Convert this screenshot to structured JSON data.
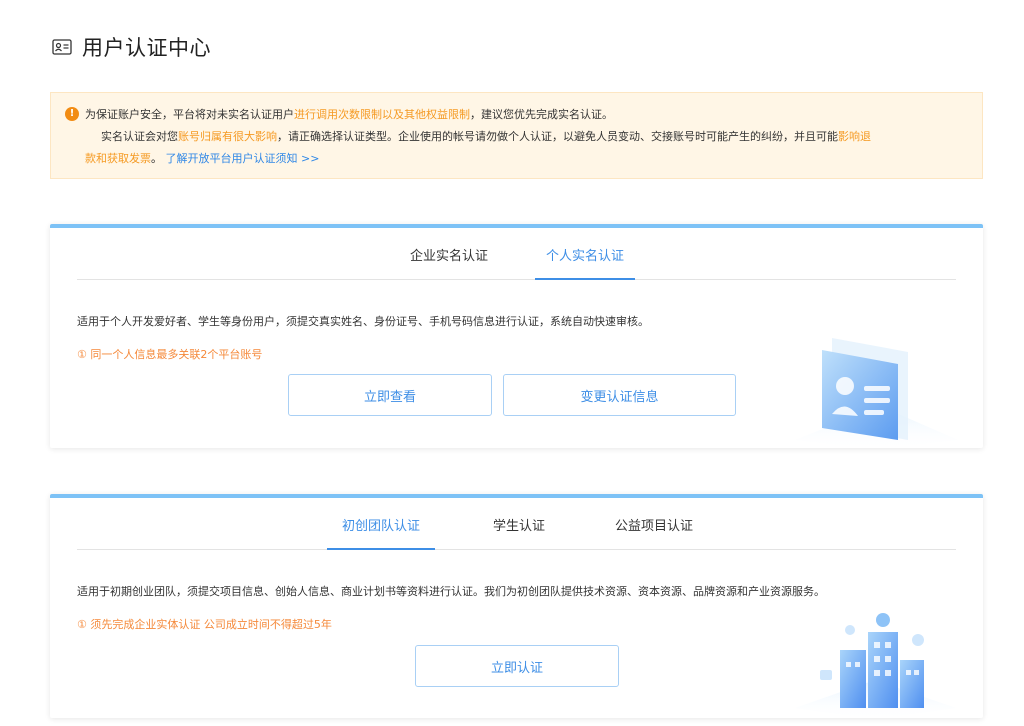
{
  "header": {
    "title": "用户认证中心",
    "icon": "id-card-icon"
  },
  "notice": {
    "icon": "warning-circle-icon",
    "line1_a": "为保证账户安全，平台将对未实名认证用户",
    "line1_hl": "进行调用次数限制以及其他权益限制",
    "line1_b": "，建议您优先完成实名认证。",
    "line2_a": "实名认证会对您",
    "line2_hl": "账号归属有很大影响",
    "line2_b": "，请正确选择认证类型。企业使用的帐号请勿做个人认证，以避免人员变动、交接账号时可能产生的纠纷，并且可能",
    "line2_hl2": "影响退",
    "line3_hl": "款和获取发票",
    "line3_b": "。",
    "line3_link": "了解开放平台用户认证须知 >>",
    "colors": {
      "background": "#fff6e6",
      "highlight": "#f59a23",
      "link": "#2f87e6"
    }
  },
  "card1": {
    "tabs": [
      {
        "label": "企业实名认证",
        "active": false
      },
      {
        "label": "个人实名认证",
        "active": true
      }
    ],
    "description": "适用于个人开发爱好者、学生等身份用户，须提交真实姓名、身份证号、手机号码信息进行认证，系统自动快速审核。",
    "tip": "① 同一个人信息最多关联2个平台账号",
    "buttons": {
      "view": "立即查看",
      "change": "变更认证信息"
    },
    "illustration": "id-card-illustration-icon"
  },
  "card2": {
    "tabs": [
      {
        "label": "初创团队认证",
        "active": true
      },
      {
        "label": "学生认证",
        "active": false
      },
      {
        "label": "公益项目认证",
        "active": false
      }
    ],
    "description": "适用于初期创业团队，须提交项目信息、创始人信息、商业计划书等资料进行认证。我们为初创团队提供技术资源、资本资源、品牌资源和产业资源服务。",
    "tip": "① 须先完成企业实体认证 公司成立时间不得超过5年",
    "buttons": {
      "certify": "立即认证"
    },
    "illustration": "startup-building-illustration-icon"
  },
  "colors": {
    "accent": "#3d8ee6",
    "card_top_border": "#7dc2f6",
    "tip": "#f5893a"
  }
}
